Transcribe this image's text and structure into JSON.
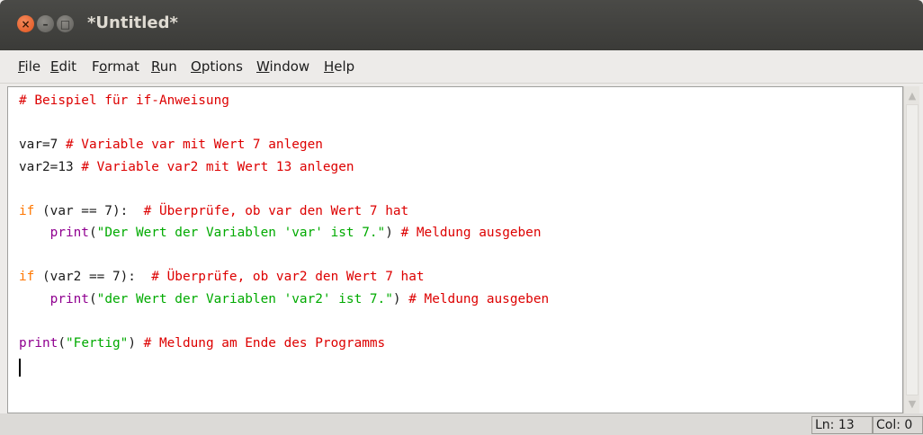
{
  "window": {
    "title": "*Untitled*",
    "close_glyph": "×",
    "minimize_glyph": "–",
    "maximize_glyph": "□"
  },
  "menu": {
    "items": [
      {
        "label": "File",
        "mnemonic": "F",
        "rest": "ile"
      },
      {
        "label": "Edit",
        "mnemonic": "E",
        "rest": "dit"
      },
      {
        "label": "Format",
        "pre": "F",
        "mnemonic": "o",
        "rest": "rmat"
      },
      {
        "label": "Run",
        "mnemonic": "R",
        "rest": "un"
      },
      {
        "label": "Options",
        "mnemonic": "O",
        "rest": "ptions"
      },
      {
        "label": "Window",
        "mnemonic": "W",
        "rest": "indow"
      },
      {
        "label": "Help",
        "mnemonic": "H",
        "rest": "elp"
      }
    ]
  },
  "editor": {
    "lines": [
      [
        {
          "t": "# Beispiel für if-Anweisung",
          "c": "cm"
        }
      ],
      [],
      [
        {
          "t": "var=7 ",
          "c": "df"
        },
        {
          "t": "# Variable var mit Wert 7 anlegen",
          "c": "cm"
        }
      ],
      [
        {
          "t": "var2=13 ",
          "c": "df"
        },
        {
          "t": "# Variable var2 mit Wert 13 anlegen",
          "c": "cm"
        }
      ],
      [],
      [
        {
          "t": "if",
          "c": "kw"
        },
        {
          "t": " (var == 7):  ",
          "c": "df"
        },
        {
          "t": "# Überprüfe, ob var den Wert 7 hat",
          "c": "cm"
        }
      ],
      [
        {
          "t": "    ",
          "c": "df"
        },
        {
          "t": "print",
          "c": "bi"
        },
        {
          "t": "(",
          "c": "df"
        },
        {
          "t": "\"Der Wert der Variablen 'var' ist 7.\"",
          "c": "str"
        },
        {
          "t": ") ",
          "c": "df"
        },
        {
          "t": "# Meldung ausgeben",
          "c": "cm"
        }
      ],
      [],
      [
        {
          "t": "if",
          "c": "kw"
        },
        {
          "t": " (var2 == 7):  ",
          "c": "df"
        },
        {
          "t": "# Überprüfe, ob var2 den Wert 7 hat",
          "c": "cm"
        }
      ],
      [
        {
          "t": "    ",
          "c": "df"
        },
        {
          "t": "print",
          "c": "bi"
        },
        {
          "t": "(",
          "c": "df"
        },
        {
          "t": "\"der Wert der Variablen 'var2' ist 7.\"",
          "c": "str"
        },
        {
          "t": ") ",
          "c": "df"
        },
        {
          "t": "# Meldung ausgeben",
          "c": "cm"
        }
      ],
      [],
      [
        {
          "t": "print",
          "c": "bi"
        },
        {
          "t": "(",
          "c": "df"
        },
        {
          "t": "\"Fertig\"",
          "c": "str"
        },
        {
          "t": ") ",
          "c": "df"
        },
        {
          "t": "# Meldung am Ende des Programms",
          "c": "cm"
        }
      ]
    ],
    "syntax_colors": {
      "keyword": "#ff7700",
      "builtin": "#900090",
      "string": "#00aa00",
      "comment": "#dd0000",
      "default": "#1a1a1a"
    }
  },
  "scrollbar": {
    "up_glyph": "▲",
    "down_glyph": "▼"
  },
  "status": {
    "line": "Ln: 13",
    "column": "Col: 0"
  }
}
